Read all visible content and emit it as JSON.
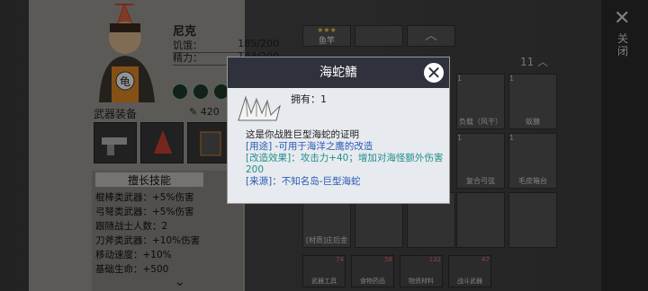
{
  "character": {
    "name": "尼克",
    "hunger_label": "饥饿：",
    "hunger_value": "185/200",
    "energy_label": "精力：",
    "energy_value": "143/200",
    "equipment_label": "武器装备",
    "power_value": "420"
  },
  "skills": {
    "tab_label": "擅长技能",
    "rows": [
      "棍棒类武器：+5%伤害",
      "弓弩类武器：+5%伤害",
      "跟随战士人数：2",
      "刀斧类武器：+10%伤害",
      "移动速度：+10%",
      "基础生命：+500"
    ]
  },
  "inventory": {
    "top_item_label": "鱼竿",
    "count_label": "11",
    "items": [
      {
        "label": "负载（风干）",
        "count": "1"
      },
      {
        "label": "蚁腺",
        "count": "1"
      },
      {
        "label": "复合弓弦",
        "count": "1"
      },
      {
        "label": "毛皮箱台",
        "count": "1"
      },
      {
        "label": "[材质]庄后金",
        "count": ""
      }
    ]
  },
  "bottom_tabs": [
    {
      "label": "武器工具",
      "badge": "74"
    },
    {
      "label": "食物药品",
      "badge": "58"
    },
    {
      "label": "物资材料",
      "badge": "132"
    },
    {
      "label": "战斗武器",
      "badge": "47"
    }
  ],
  "close_panel_label": "关闭",
  "modal": {
    "title": "海蛇鳍",
    "owned_label": "拥有：",
    "owned_value": "1",
    "description": "这是你战胜巨型海蛇的证明",
    "usage": "[用途] -可用于海洋之鹰的改造",
    "effect": "[改造效果]：攻击力+40；增加对海怪额外伤害200",
    "source": "[来源]：不知名岛-巨型海蛇"
  }
}
